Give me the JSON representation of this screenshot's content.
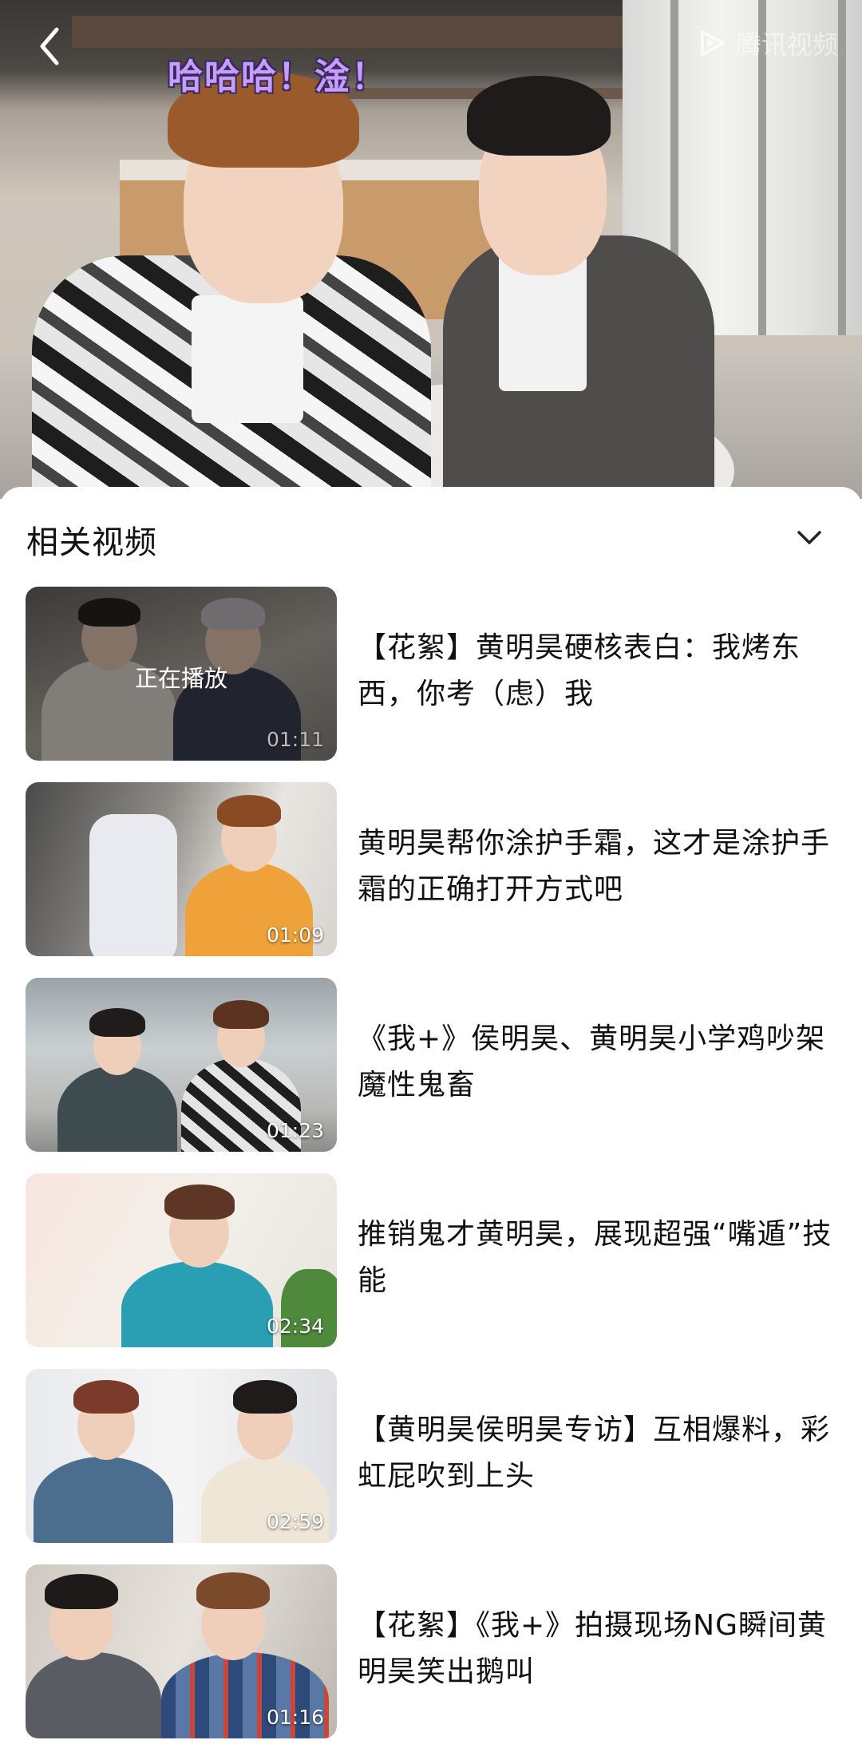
{
  "video": {
    "subtitle": "哈哈哈！淦！",
    "watermark_text": "腾讯视频"
  },
  "panel": {
    "title": "相关视频"
  },
  "videos": [
    {
      "title": "【花絮】黄明昊硬核表白：我烤东西，你考（虑）我",
      "duration": "01:11",
      "playing_label": "正在播放"
    },
    {
      "title": "黄明昊帮你涂护手霜，这才是涂护手霜的正确打开方式吧",
      "duration": "01:09"
    },
    {
      "title": "《我+》侯明昊、黄明昊小学鸡吵架魔性鬼畜",
      "duration": "01:23"
    },
    {
      "title": "推销鬼才黄明昊，展现超强“嘴遁”技能",
      "duration": "02:34"
    },
    {
      "title": "【黄明昊侯明昊专访】互相爆料，彩虹屁吹到上头",
      "duration": "02:59"
    },
    {
      "title": "【花絮】《我+》拍摄现场NG瞬间黄明昊笑出鹅叫",
      "duration": "01:16"
    }
  ],
  "icons": {
    "back": "chevron-left-icon",
    "collapse": "chevron-down-icon",
    "watermark": "tencent-video-logo-icon"
  },
  "colors": {
    "subtitle": "#c79cff",
    "panel_bg": "#ffffff",
    "title_text": "#111111"
  }
}
